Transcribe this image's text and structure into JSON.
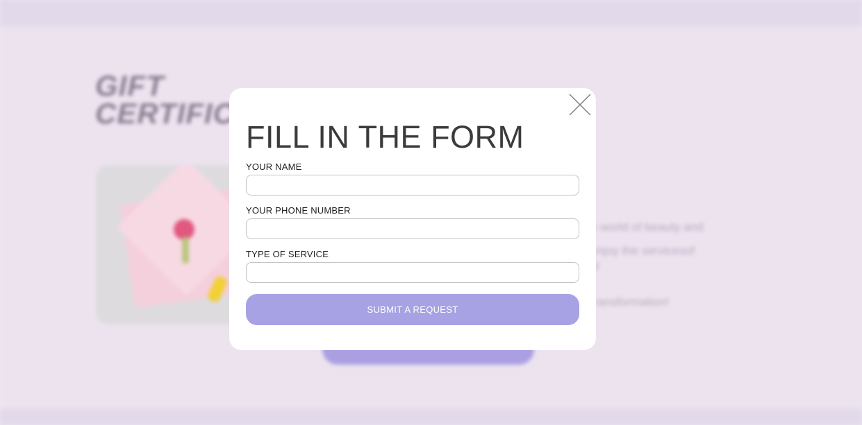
{
  "background": {
    "title_line1": "GIFT",
    "title_line2": "CERTIFIC",
    "text_line1": "e world of beauty and",
    "text_line2": "enjoy the servicesof",
    "text_line3": "ty",
    "text_line4": "transformation!"
  },
  "modal": {
    "title": "FILL IN THE FORM",
    "close_icon": "close-x-icon",
    "fields": [
      {
        "label": "YOUR NAME",
        "value": "",
        "placeholder": ""
      },
      {
        "label": "YOUR PHONE NUMBER",
        "value": "",
        "placeholder": ""
      },
      {
        "label": "TYPE OF SERVICE",
        "value": "",
        "placeholder": ""
      }
    ],
    "submit_label": "SUBMIT A REQUEST"
  },
  "colors": {
    "page_background": "#ece3ef",
    "modal_background": "#ffffff",
    "title_text": "#3d3a3c",
    "submit_button": "#a7a2e3",
    "submit_text": "#ffffff"
  }
}
